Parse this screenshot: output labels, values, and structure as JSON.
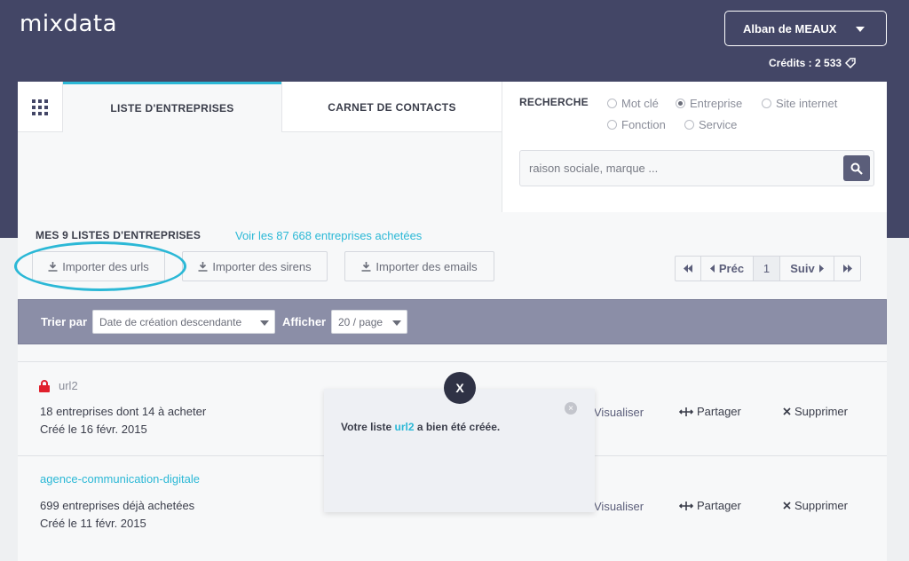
{
  "app": {
    "logo": "mixdata"
  },
  "user": {
    "name": "Alban de MEAUX"
  },
  "credits": {
    "label": "Crédits : 2 533"
  },
  "tabs": [
    {
      "label": "LISTE D'ENTREPRISES"
    },
    {
      "label": "CARNET DE CONTACTS"
    }
  ],
  "search": {
    "label": "RECHERCHE",
    "options": [
      {
        "label": "Mot clé",
        "checked": false
      },
      {
        "label": "Entreprise",
        "checked": true
      },
      {
        "label": "Site internet",
        "checked": false
      },
      {
        "label": "Fonction",
        "checked": false
      },
      {
        "label": "Service",
        "checked": false
      }
    ],
    "placeholder": "raison sociale, marque ..."
  },
  "lists": {
    "title": "MES 9 LISTES D'ENTREPRISES",
    "link": "Voir les 87 668 entreprises achetées"
  },
  "import_buttons": {
    "urls": "Importer des urls",
    "sirens": "Importer des sirens",
    "emails": "Importer des emails"
  },
  "pager": {
    "prev": "Préc",
    "page": "1",
    "next": "Suiv"
  },
  "sort": {
    "sort_label": "Trier par",
    "sort_value": "Date de création descendante",
    "show_label": "Afficher",
    "show_value": "20 / page"
  },
  "rows": [
    {
      "name": "url2",
      "locked": true,
      "line1": "18 entreprises dont 14 à acheter",
      "line2": "Créé le 16 févr. 2015",
      "visualiser": "Visualiser",
      "partager": "Partager",
      "supprimer": "Supprimer"
    },
    {
      "name": "agence-communication-digitale",
      "locked": false,
      "line1": "699 entreprises déjà achetées",
      "line2": "Créé le 11 févr. 2015",
      "visualiser": "Visualiser",
      "partager": "Partager",
      "supprimer": "Supprimer"
    }
  ],
  "toast": {
    "close_label": "X",
    "msg_before": "Votre liste",
    "msg_name": "url2",
    "msg_after": "a bien été créée."
  },
  "colors": {
    "header": "#434666",
    "accent": "#2bb8d6",
    "sortbar": "#8b8ea7",
    "lock": "#e0202c"
  },
  "icons": [
    "grid-icon",
    "caret-down-icon",
    "tag-icon",
    "search-icon",
    "download-icon",
    "first-page-icon",
    "prev-icon",
    "next-icon",
    "last-page-icon",
    "lock-icon",
    "share-icon",
    "delete-icon",
    "close-icon"
  ]
}
